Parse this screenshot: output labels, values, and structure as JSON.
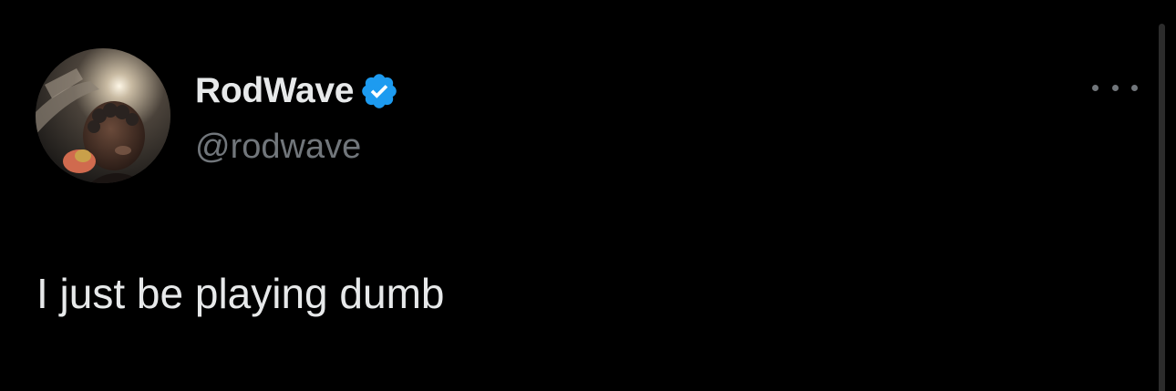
{
  "tweet": {
    "author": {
      "display_name": "RodWave",
      "handle": "@rodwave",
      "verified": true,
      "verified_color": "#1d9bf0"
    },
    "text": "I just be playing dumb",
    "more_icon": "more-horizontal-icon"
  },
  "theme": {
    "background": "#000000",
    "primary_text": "#e7e9ea",
    "secondary_text": "#71767b"
  }
}
